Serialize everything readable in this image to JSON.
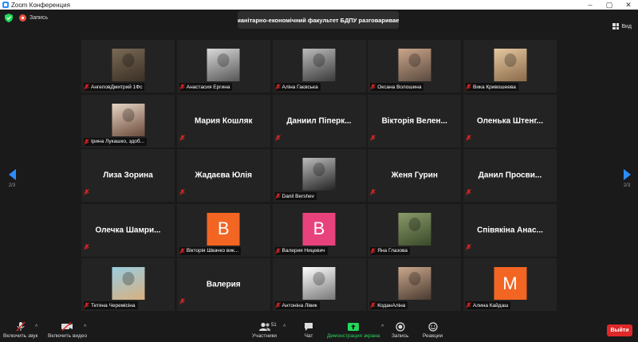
{
  "window": {
    "title": "Zoom Конференция",
    "controls": [
      "–",
      "▢",
      "✕"
    ]
  },
  "topbar": {
    "recording_label": "Запись",
    "speaker_banner": "Гуманітарно-економічний факультет БДПУ разговаривает...",
    "view_label": "Вид"
  },
  "navigation": {
    "left_page": "2/3",
    "right_page": "2/3"
  },
  "colors": {
    "accent": "#2d8cff",
    "muted": "#e02828",
    "share": "#23d959",
    "avatar_orange": "#f26522",
    "avatar_pink": "#e8427c"
  },
  "participants": [
    {
      "kind": "photo",
      "photo": "p1",
      "label": "АнгеловДмитрий 1Фс"
    },
    {
      "kind": "photo",
      "photo": "p2",
      "label": "Анастасия Ергина"
    },
    {
      "kind": "photo",
      "photo": "p3",
      "label": "Аліна Гаєвська"
    },
    {
      "kind": "photo",
      "photo": "p4",
      "label": "Оксана Волошина"
    },
    {
      "kind": "photo",
      "photo": "p5",
      "label": "Вика Кривошеева"
    },
    {
      "kind": "photo",
      "photo": "p6",
      "label": "Ірина Лукашко, здоб..."
    },
    {
      "kind": "name",
      "name": "Мария Кошляк"
    },
    {
      "kind": "name",
      "name": "Даниил Піперк..."
    },
    {
      "kind": "name",
      "name": "Вікторія Велен..."
    },
    {
      "kind": "name",
      "name": "Оленька Штенг..."
    },
    {
      "kind": "name",
      "name": "Лиза Зорина"
    },
    {
      "kind": "name",
      "name": "Жадаєва Юлія"
    },
    {
      "kind": "photo",
      "photo": "p7",
      "label": "Danil Bershev"
    },
    {
      "kind": "name",
      "name": "Женя Гурин"
    },
    {
      "kind": "name",
      "name": "Данил Просви..."
    },
    {
      "kind": "name",
      "name": "Олечка Шамри..."
    },
    {
      "kind": "avatar",
      "letter": "B",
      "color": "#f26522",
      "label": "Вікторія Швачко вик..."
    },
    {
      "kind": "avatar",
      "letter": "B",
      "color": "#e8427c",
      "label": "Валерия Ницевич"
    },
    {
      "kind": "photo",
      "photo": "p8",
      "label": "Яна Глазова"
    },
    {
      "kind": "name",
      "name": "Співякіна Анас..."
    },
    {
      "kind": "photo",
      "photo": "p9",
      "label": "Тетяна Черемісіна"
    },
    {
      "kind": "name",
      "name": "Валерия"
    },
    {
      "kind": "photo",
      "photo": "p10",
      "label": "Антоніна Лівик"
    },
    {
      "kind": "photo",
      "photo": "p11",
      "label": "КоданАліна"
    },
    {
      "kind": "avatar",
      "letter": "M",
      "color": "#f26522",
      "label": "Алина Кайдаш"
    }
  ],
  "toolbar": {
    "audio_label": "Включить звук",
    "video_label": "Включить видео",
    "participants_label": "Участники",
    "participants_count": "51",
    "chat_label": "Чат",
    "share_label": "Демонстрация экрана",
    "record_label": "Запись",
    "reactions_label": "Реакции",
    "leave_label": "Выйти",
    "caret": "^"
  }
}
